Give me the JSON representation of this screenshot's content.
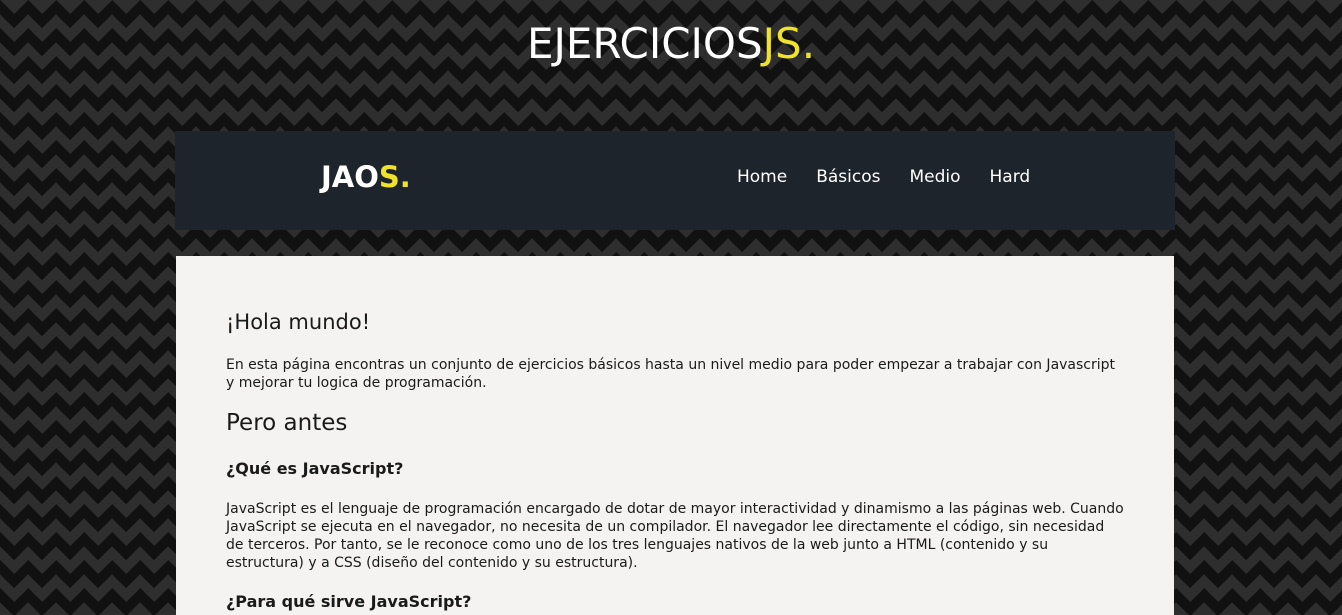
{
  "header": {
    "title_main": "EJERCICIOS",
    "title_accent": "JS."
  },
  "navbar": {
    "logo_main": "JAO",
    "logo_accent": "S.",
    "links": [
      "Home",
      "Básicos",
      "Medio",
      "Hard"
    ]
  },
  "content": {
    "greeting": "¡Hola mundo!",
    "intro": "En esta página encontras un conjunto de ejercicios básicos hasta un nivel medio para poder empezar a trabajar con Javascript y mejorar tu logica de programación.",
    "section_title": "Pero antes",
    "question1": "¿Qué es JavaScript?",
    "answer1": "JavaScript es el lenguaje de programación encargado de dotar de mayor interactividad y dinamismo a las páginas web. Cuando JavaScript se ejecuta en el navegador, no necesita de un compilador. El navegador lee directamente el código, sin necesidad de terceros. Por tanto, se le reconoce como uno de los tres lenguajes nativos de la web junto a HTML (contenido y su estructura) y a CSS (diseño del contenido y su estructura).",
    "question2": "¿Para qué sirve JavaScript?"
  },
  "colors": {
    "accent": "#f0e22a",
    "navbar_bg": "#1d242c",
    "content_bg": "#f4f3f1"
  }
}
